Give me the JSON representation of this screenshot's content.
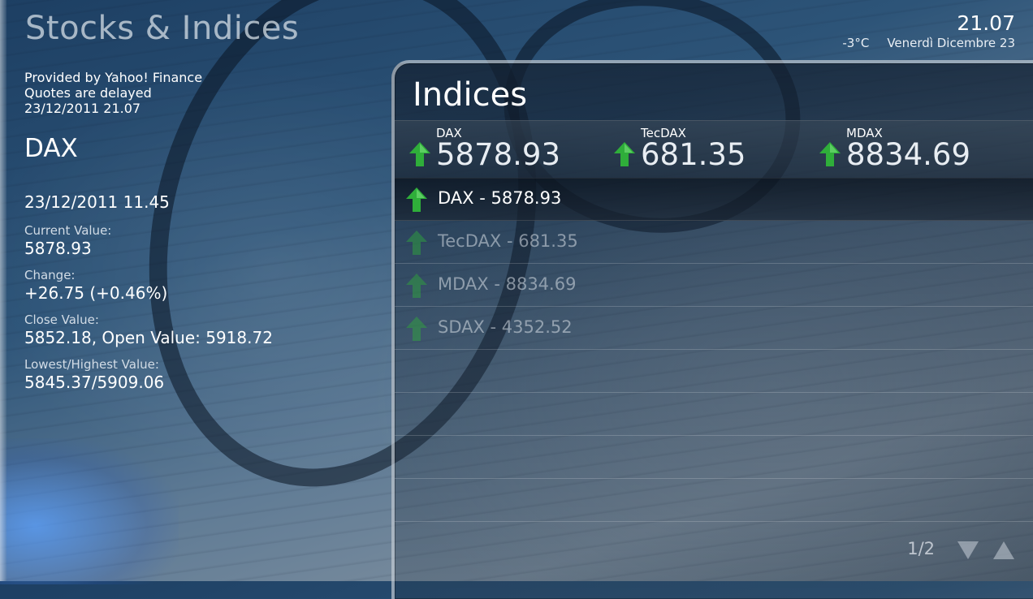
{
  "app": {
    "title": "Stocks & Indices"
  },
  "status": {
    "time": "21.07",
    "temperature": "-3°C",
    "date": "Venerdì Dicembre 23"
  },
  "details": {
    "provider_lines": [
      "Provided by Yahoo! Finance",
      "Quotes are delayed",
      "23/12/2011 21.07"
    ],
    "symbol": "DAX",
    "quote_time": "23/12/2011 11.45",
    "fields": [
      {
        "label": "Current Value:",
        "value": "5878.93"
      },
      {
        "label": "Change:",
        "value": "+26.75 (+0.46%)"
      },
      {
        "label": "Close Value:",
        "value": "5852.18, Open Value: 5918.72"
      },
      {
        "label": "Lowest/Highest Value:",
        "value": "5845.37/5909.06"
      }
    ]
  },
  "panel": {
    "title": "Indices",
    "tickers": [
      {
        "name": "DAX",
        "value": "5878.93",
        "trend": "up-arrow-icon"
      },
      {
        "name": "TecDAX",
        "value": "681.35",
        "trend": "up-arrow-icon"
      },
      {
        "name": "MDAX",
        "value": "8834.69",
        "trend": "up-arrow-icon"
      }
    ],
    "list": [
      {
        "label": "DAX - 5878.93",
        "trend": "up-arrow-icon",
        "selected": true
      },
      {
        "label": "TecDAX - 681.35",
        "trend": "up-arrow-icon",
        "selected": false
      },
      {
        "label": "MDAX - 8834.69",
        "trend": "up-arrow-icon",
        "selected": false
      },
      {
        "label": "SDAX - 4352.52",
        "trend": "up-arrow-icon",
        "selected": false
      }
    ],
    "pager": {
      "page_count": "1/2"
    }
  },
  "colors": {
    "arrow_up": "#2fae3a",
    "accent_text": "#ffffff"
  }
}
